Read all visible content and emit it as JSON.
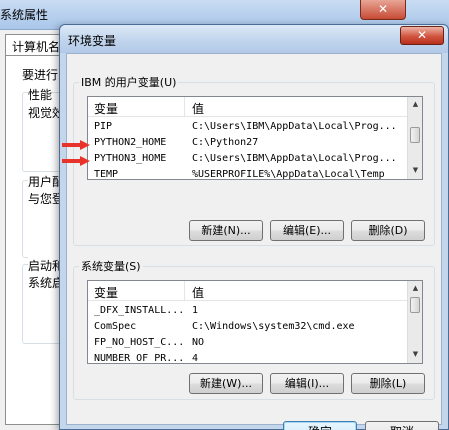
{
  "background_window": {
    "title": "系统属性",
    "close_glyph": "✕",
    "tab_label": "计算机名",
    "content": {
      "line1": "要进行",
      "group_performance": "性能",
      "performance_desc": "视觉效",
      "group_user_profile": "用户配",
      "user_profile_desc": "与您登",
      "group_startup": "启动和",
      "startup_desc": "系统启"
    }
  },
  "dialog": {
    "title": "环境变量",
    "close_glyph": "✕",
    "user_vars": {
      "group_label": "IBM 的用户变量(U)",
      "columns": [
        "变量",
        "值"
      ],
      "rows": [
        {
          "name": "PIP",
          "value": "C:\\Users\\IBM\\AppData\\Local\\Prog..."
        },
        {
          "name": "PYTHON2_HOME",
          "value": "C:\\Python27"
        },
        {
          "name": "PYTHON3_HOME",
          "value": "C:\\Users\\IBM\\AppData\\Local\\Prog..."
        },
        {
          "name": "TEMP",
          "value": "%USERPROFILE%\\AppData\\Local\\Temp"
        }
      ],
      "buttons": {
        "new": "新建(N)...",
        "edit": "编辑(E)...",
        "delete": "删除(D)"
      }
    },
    "system_vars": {
      "group_label": "系统变量(S)",
      "columns": [
        "变量",
        "值"
      ],
      "rows": [
        {
          "name": "_DFX_INSTALL...",
          "value": "1"
        },
        {
          "name": "ComSpec",
          "value": "C:\\Windows\\system32\\cmd.exe"
        },
        {
          "name": "FP_NO_HOST_C...",
          "value": "NO"
        },
        {
          "name": "NUMBER_OF_PR...",
          "value": "4"
        }
      ],
      "buttons": {
        "new": "新建(W)...",
        "edit": "编辑(I)...",
        "delete": "删除(L)"
      }
    },
    "ok_label": "确定",
    "cancel_label": "取消"
  },
  "colors": {
    "annotation_arrow": "#e8332a",
    "default_button_border": "#3c7fb1",
    "dialog_frame": "#c4d6ec"
  },
  "icons": [
    "close-icon",
    "scroll-up-arrow-icon",
    "scroll-down-arrow-icon",
    "red-arrow-icon"
  ]
}
